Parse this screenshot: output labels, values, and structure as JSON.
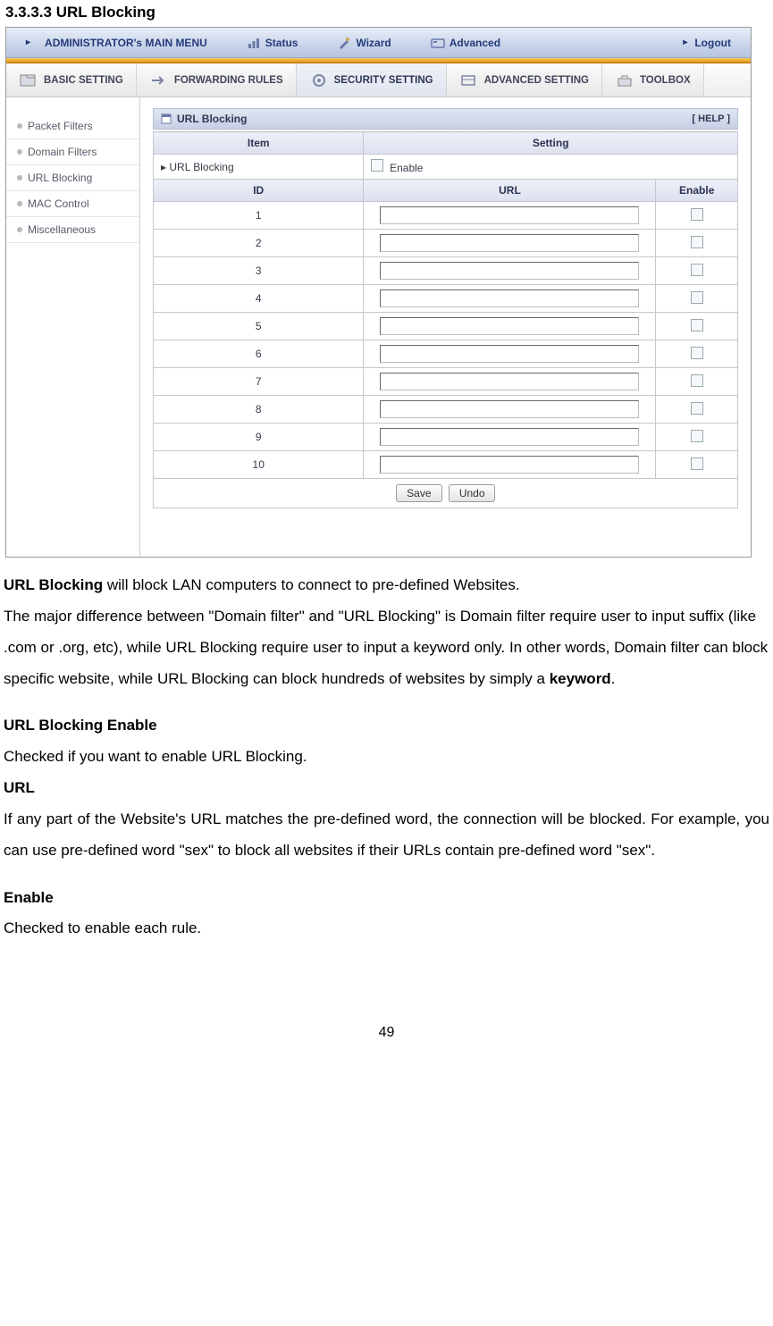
{
  "heading": "3.3.3.3 URL Blocking",
  "router": {
    "mainMenu": "ADMINISTRATOR's MAIN MENU",
    "top": {
      "status": "Status",
      "wizard": "Wizard",
      "advanced": "Advanced",
      "logout": "Logout"
    },
    "tabs": {
      "basic": "BASIC SETTING",
      "forwarding": "FORWARDING RULES",
      "security": "SECURITY SETTING",
      "advanced": "ADVANCED SETTING",
      "toolbox": "TOOLBOX"
    },
    "sidebar": [
      "Packet Filters",
      "Domain Filters",
      "URL Blocking",
      "MAC Control",
      "Miscellaneous"
    ],
    "panel": {
      "title": "URL Blocking",
      "help": "[ HELP ]",
      "headers": {
        "item": "Item",
        "setting": "Setting",
        "id": "ID",
        "url": "URL",
        "enable": "Enable"
      },
      "rowLabel": "URL Blocking",
      "rowEnable": "Enable",
      "ids": [
        "1",
        "2",
        "3",
        "4",
        "5",
        "6",
        "7",
        "8",
        "9",
        "10"
      ],
      "buttons": {
        "save": "Save",
        "undo": "Undo"
      }
    }
  },
  "doc": {
    "p1a": "URL Blocking",
    "p1b": " will block LAN computers to connect to pre-defined Websites.",
    "p2": "The major difference between \"Domain filter\" and \"URL Blocking\" is Domain filter require user to input suffix (like .com or .org, etc), while URL Blocking require user to input a keyword only. In other words, Domain filter can block specific website, while URL Blocking can block hundreds of websites by simply a ",
    "p2k": "keyword",
    "p2end": ".",
    "h_enable": "URL Blocking Enable",
    "t_enable": "Checked if you want to enable URL Blocking.",
    "h_url": "URL",
    "t_url": "If any part of the Website's URL matches the pre-defined word, the connection will be blocked. For example, you can use pre-defined word \"sex\" to block all websites if their URLs contain pre-defined word \"sex\".",
    "h_enable2": "Enable",
    "t_enable2": "Checked to enable each rule."
  },
  "pageNumber": "49"
}
